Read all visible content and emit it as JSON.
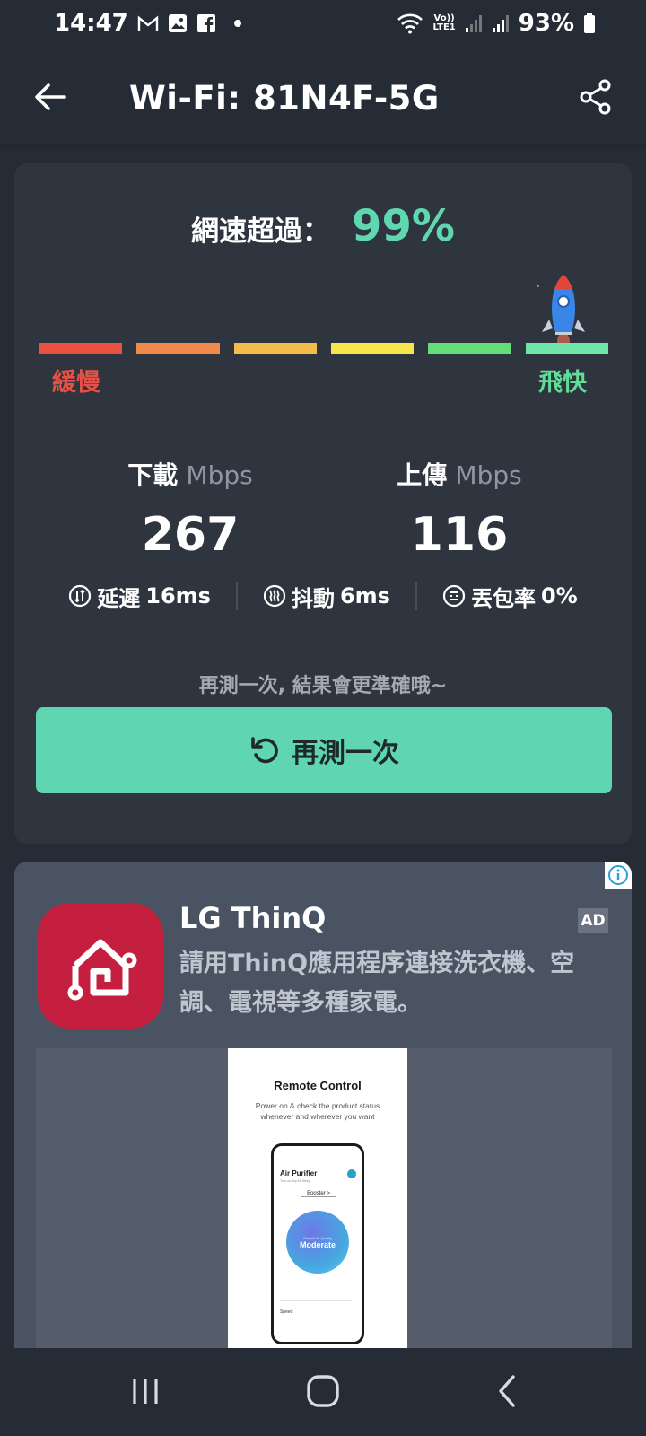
{
  "status_bar": {
    "time": "14:47",
    "notification_icons": [
      "gmail-icon",
      "gallery-icon",
      "facebook-icon",
      "dot-icon"
    ],
    "volte_label_top": "Vo))",
    "volte_label_bottom": "LTE1",
    "battery": "93%"
  },
  "app_bar": {
    "title": "Wi-Fi: 81N4F-5G"
  },
  "result": {
    "headline_label": "網速超過：",
    "headline_value": "99%",
    "scale_slow_label": "緩慢",
    "scale_fast_label": "飛快",
    "scale_colors": [
      "#e8503f",
      "#ef8a4b",
      "#f3bc4b",
      "#f6e64a",
      "#62dd77",
      "#6fe5a8"
    ],
    "speed_level": "segment 6 of 6",
    "download": {
      "label": "下載",
      "unit": "Mbps",
      "value": "267"
    },
    "upload": {
      "label": "上傳",
      "unit": "Mbps",
      "value": "116"
    },
    "latency": {
      "label": "延遲",
      "value": "16ms"
    },
    "jitter": {
      "label": "抖動",
      "value": "6ms"
    },
    "packet_loss": {
      "label": "丟包率",
      "value": "0%"
    },
    "retest_hint": "再測一次, 結果會更準確哦~",
    "retest_button": "再測一次"
  },
  "ad": {
    "app_name": "LG ThinQ",
    "badge": "AD",
    "description": "請用ThinQ應用程序連接洗衣機、空調、電視等多種家電。",
    "screenshot": {
      "title": "Remote Control",
      "subtitle": "Power on & check the product status whenever and wherever you want",
      "phone_title": "Air Purifier",
      "phone_subtitle": "Turn on Any Air Sleep",
      "booster": "Booster >",
      "circle_sub": "Overall Air Quality",
      "circle_main": "Moderate",
      "speed_label": "Speed"
    }
  },
  "colors": {
    "background": "#262c36",
    "card": "#2f353f",
    "accent": "#5fd6b1",
    "ad_card": "#4a5362",
    "lg_red": "#c51f3f"
  }
}
